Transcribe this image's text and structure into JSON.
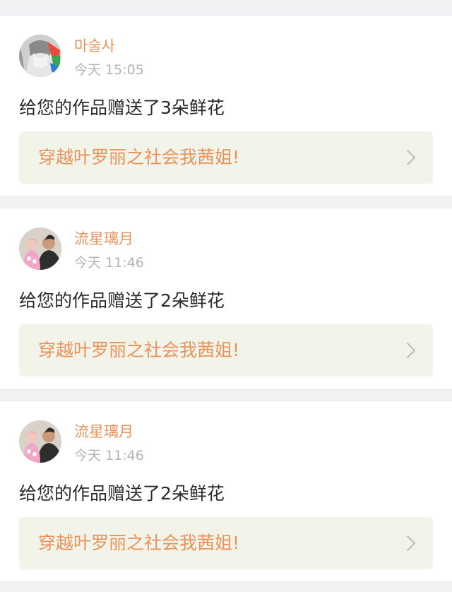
{
  "notifications": [
    {
      "username": "마술사",
      "time": "今天 15:05",
      "message": "给您的作品赠送了3朵鲜花",
      "work_title": "穿越叶罗丽之社会我茜姐!",
      "avatar_icon": "anime-girl-avatar"
    },
    {
      "username": "流星璃月",
      "time": "今天 11:46",
      "message": "给您的作品赠送了2朵鲜花",
      "work_title": "穿越叶罗丽之社会我茜姐!",
      "avatar_icon": "family-photo-avatar"
    },
    {
      "username": "流星璃月",
      "time": "今天 11:46",
      "message": "给您的作品赠送了2朵鲜花",
      "work_title": "穿越叶罗丽之社会我茜姐!",
      "avatar_icon": "family-photo-avatar"
    }
  ],
  "colors": {
    "username": "#e8935a",
    "timestamp": "#b4b4b4",
    "message": "#2b2b2b",
    "link_background": "#f2f3e9",
    "page_background": "#f1f1f3"
  }
}
